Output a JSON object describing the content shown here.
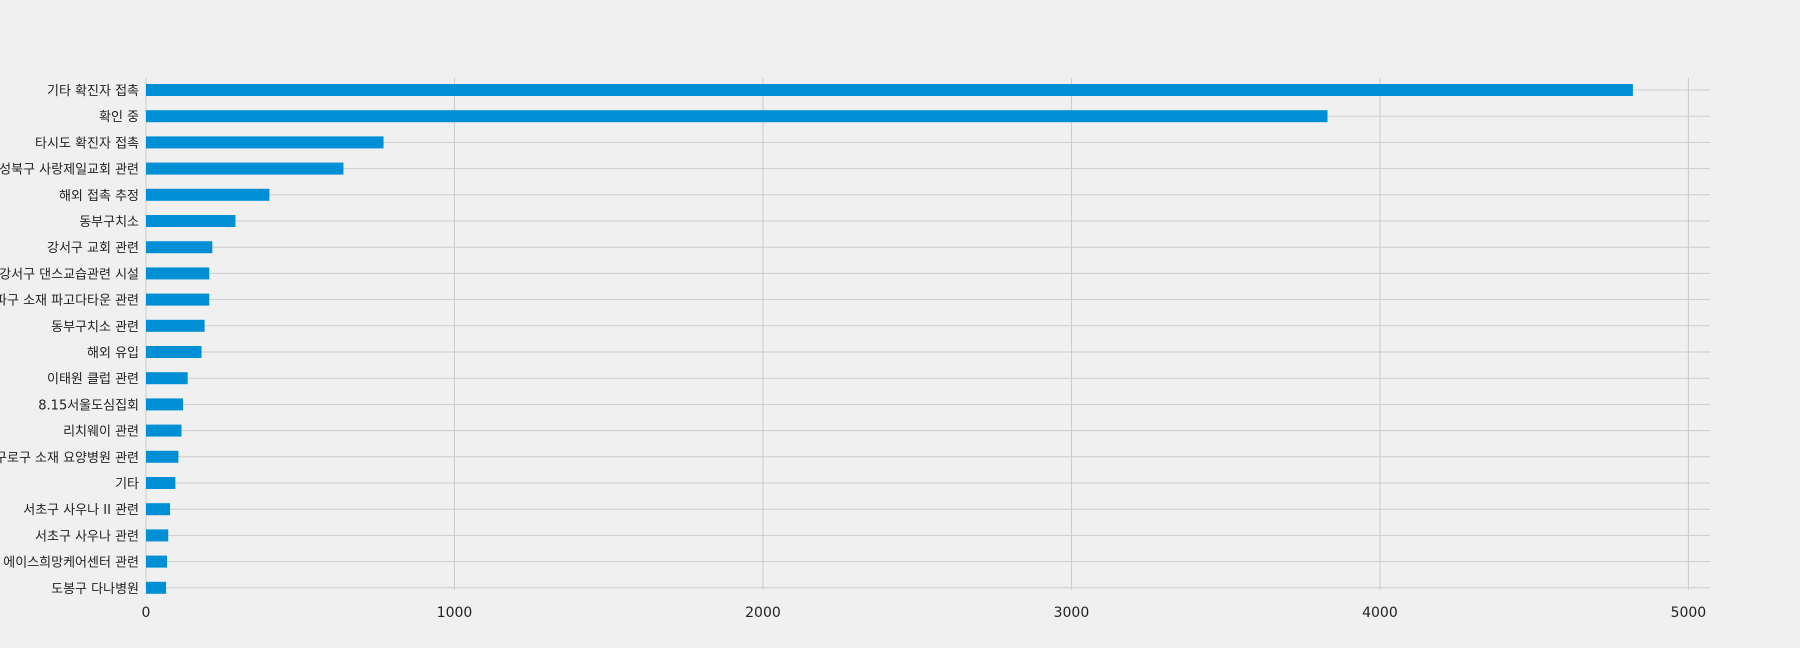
{
  "chart_data": {
    "type": "bar",
    "orientation": "horizontal",
    "title": "",
    "xlabel": "",
    "ylabel": "",
    "xlim": [
      0,
      5070
    ],
    "xticks": [
      0,
      1000,
      2000,
      3000,
      4000,
      5000
    ],
    "grid": true,
    "bar_color": "#008fd5",
    "background_color": "#f0f0f0",
    "grid_color": "#cbcbcb",
    "categories": [
      "기타 확진자 접촉",
      "확인 중",
      "타시도 확진자 접촉",
      "성북구 사랑제일교회 관련",
      "해외 접촉 추정",
      "동부구치소",
      "강서구 교회 관련",
      "강서구 댄스교습관련 시설",
      "송파구 소재 파고다타운 관련",
      "동부구치소 관련",
      "해외 유입",
      "이태원 클럽 관련",
      "8.15서울도심집회",
      "리치웨이 관련",
      "구로구 소재 요양병원 관련",
      "기타",
      "서초구 사우나 II 관련",
      "서초구 사우나 관련",
      "강서구 에이스희망케어센터 관련",
      "도봉구 다나병원"
    ],
    "values": [
      4820,
      3830,
      770,
      640,
      400,
      290,
      215,
      205,
      205,
      190,
      180,
      135,
      120,
      115,
      105,
      95,
      78,
      72,
      68,
      65
    ]
  }
}
